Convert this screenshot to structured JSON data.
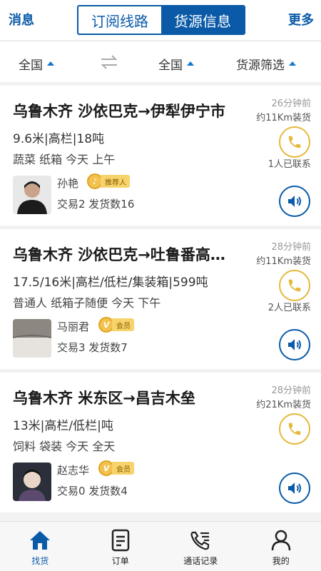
{
  "header": {
    "left_label": "消息",
    "right_label": "更多",
    "tabs": [
      {
        "label": "订阅线路",
        "active": false
      },
      {
        "label": "货源信息",
        "active": true
      }
    ]
  },
  "filters": {
    "origin": "全国",
    "destination": "全国",
    "screen": "货源筛选",
    "swap_icon": "swap-arrows-icon"
  },
  "listings": [
    {
      "route": "乌鲁木齐 沙依巴克→伊犁伊宁市",
      "spec": "9.6米|高栏|18吨",
      "goods": "蔬菜 纸箱 今天 上午",
      "time": "26分钟前",
      "distance": "约11Km装货",
      "contacts": "1人已联系",
      "user": {
        "name": "孙艳",
        "badge": "推荐人",
        "badge_glyph": "♪"
      },
      "stats": "交易2 发货数16"
    },
    {
      "route": "乌鲁木齐 沙依巴克→吐鲁番高昌区",
      "spec": "17.5/16米|高栏/低栏/集装箱|599吨",
      "goods": "普通人 纸箱子随便 今天 下午",
      "time": "28分钟前",
      "distance": "约11Km装货",
      "contacts": "2人已联系",
      "user": {
        "name": "马丽君",
        "badge": "会员",
        "badge_glyph": "V"
      },
      "stats": "交易3 发货数7"
    },
    {
      "route": "乌鲁木齐 米东区→昌吉木垒",
      "spec": "13米|高栏/低栏|吨",
      "goods": "饲料 袋装 今天 全天",
      "time": "28分钟前",
      "distance": "约21Km装货",
      "contacts": "",
      "user": {
        "name": "赵志华",
        "badge": "会员",
        "badge_glyph": "V"
      },
      "stats": "交易0 发货数4"
    }
  ],
  "tabbar": [
    {
      "label": "找货",
      "icon": "home-icon",
      "active": true
    },
    {
      "label": "订单",
      "icon": "document-icon",
      "active": false
    },
    {
      "label": "通话记录",
      "icon": "call-log-icon",
      "active": false
    },
    {
      "label": "我的",
      "icon": "profile-icon",
      "active": false
    }
  ],
  "colors": {
    "primary": "#0a5aa8",
    "phone_ring": "#e6b83a",
    "badge": "#f7d36b"
  }
}
